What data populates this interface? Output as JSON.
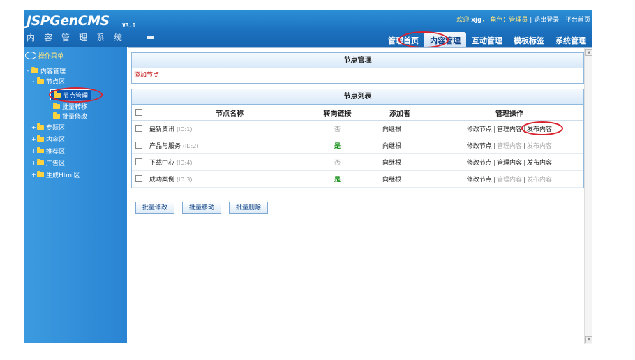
{
  "header": {
    "logo": "JSPGenCMS",
    "version": "V3.0",
    "subtitle": "内容管理系统",
    "welcome": "欢迎",
    "username": "xjg",
    "role_label": "角色：管理员",
    "logout": "退出登录",
    "platform_home": "平台首页",
    "nav": [
      "管理首页",
      "内容管理",
      "互动管理",
      "模板标签",
      "系统管理"
    ]
  },
  "sidebar": {
    "title": "操作菜单",
    "root": "内容管理",
    "node_area": "节点区",
    "node_children": [
      "节点管理",
      "批量转移",
      "批量修改"
    ],
    "other_areas": [
      "专题区",
      "内容区",
      "推荐区",
      "广告区",
      "生成Html区"
    ]
  },
  "node_panel": {
    "title": "节点管理",
    "add_link": "添加节点"
  },
  "list_panel": {
    "title": "节点列表",
    "columns": [
      "节点名称",
      "转向链接",
      "添加者",
      "管理操作"
    ],
    "rows": [
      {
        "name": "最新资讯",
        "id": "(ID:1)",
        "redirect": "否",
        "adder": "向继根"
      },
      {
        "name": "产品与服务",
        "id": "(ID:2)",
        "redirect": "是",
        "adder": "向继根"
      },
      {
        "name": "下载中心",
        "id": "(ID:4)",
        "redirect": "否",
        "adder": "向继根"
      },
      {
        "name": "成功案例",
        "id": "(ID:3)",
        "redirect": "是",
        "adder": "向继根"
      }
    ],
    "ops": {
      "edit": "修改节点",
      "manage": "管理内容",
      "publish": "发布内容"
    }
  },
  "buttons": [
    "批量修改",
    "批量移动",
    "批量删除"
  ],
  "colors": {
    "header": "#1b6fbd",
    "sidebar": "#3c9be0",
    "highlight": "#d9232e"
  }
}
